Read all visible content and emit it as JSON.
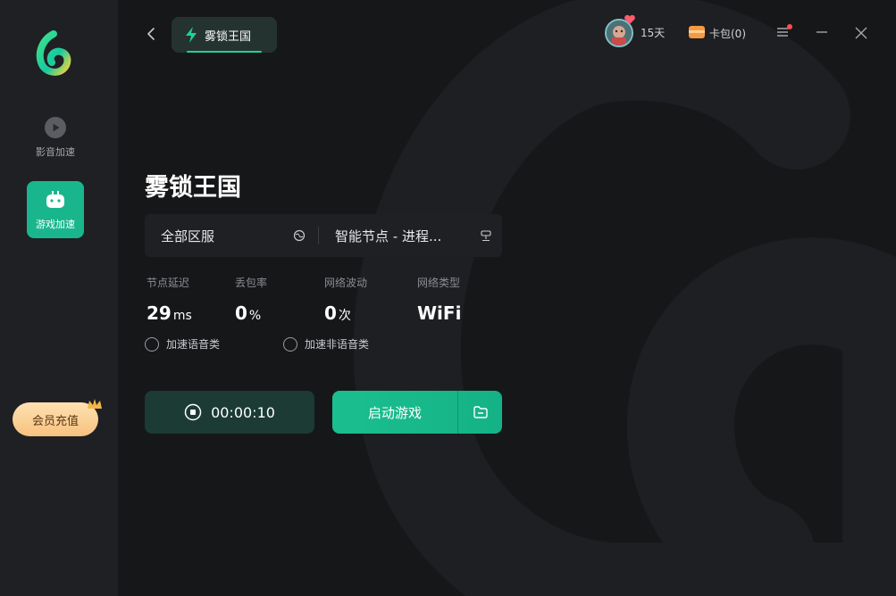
{
  "sidebar": {
    "items": [
      {
        "label": "影音加速",
        "icon": "play-circle-icon",
        "active": false
      },
      {
        "label": "游戏加速",
        "icon": "gamepad-icon",
        "active": true
      }
    ],
    "vip_button": "会员充值"
  },
  "header": {
    "tab_label": "雾锁王国",
    "membership_days": "15天",
    "card_wallet": "卡包(0)"
  },
  "game": {
    "title": "雾锁王国",
    "region": "全部区服",
    "node": "智能节点 - 进程..."
  },
  "stats": [
    {
      "label": "节点延迟",
      "value": "29",
      "unit": "ms"
    },
    {
      "label": "丢包率",
      "value": "0",
      "unit": "%"
    },
    {
      "label": "网络波动",
      "value": "0",
      "unit": "次"
    },
    {
      "label": "网络类型",
      "value": "WiFi",
      "unit": ""
    }
  ],
  "options": {
    "voice": "加速语音类",
    "non_voice": "加速非语音类"
  },
  "actions": {
    "timer": "00:00:10",
    "launch": "启动游戏"
  },
  "colors": {
    "accent": "#19b68d",
    "background": "#161719",
    "sidebar": "#1f2023",
    "vip": "#f6c27e"
  }
}
